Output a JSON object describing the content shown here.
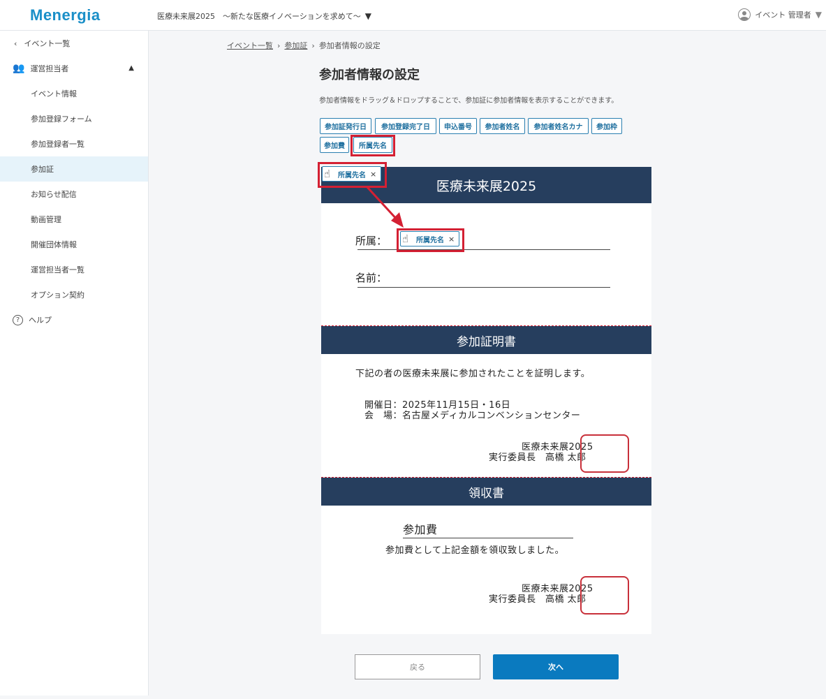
{
  "header": {
    "logo": "Menergia",
    "event_name": "医療未来展2025　～新たな医療イノベーションを求めて～",
    "user_name": "イベント 管理者"
  },
  "sidebar": {
    "back_label": "イベント一覧",
    "group_label": "運営担当者",
    "items": [
      {
        "label": "イベント情報"
      },
      {
        "label": "参加登録フォーム"
      },
      {
        "label": "参加登録者一覧"
      },
      {
        "label": "参加証"
      },
      {
        "label": "お知らせ配信"
      },
      {
        "label": "動画管理"
      },
      {
        "label": "開催団体情報"
      },
      {
        "label": "運営担当者一覧"
      },
      {
        "label": "オプション契約"
      }
    ],
    "help_label": "ヘルプ"
  },
  "breadcrumb": {
    "item1": "イベント一覧",
    "item2": "参加証",
    "current": "参加者情報の設定"
  },
  "page": {
    "title": "参加者情報の設定",
    "description": "参加者情報をドラッグ＆ドロップすることで、参加証に参加者情報を表示することができます。"
  },
  "chips": [
    {
      "label": "参加証発行日"
    },
    {
      "label": "参加登録完了日"
    },
    {
      "label": "申込番号"
    },
    {
      "label": "参加者姓名"
    },
    {
      "label": "参加者姓名カナ"
    },
    {
      "label": "参加枠"
    },
    {
      "label": "参加費"
    },
    {
      "label": "所属先名"
    }
  ],
  "drag_chip": {
    "label": "所属先名",
    "close": "×"
  },
  "dropped_chip": {
    "label": "所属先名",
    "close": "×"
  },
  "badge": {
    "title": "医療未来展2025",
    "affiliation_label": "所属：",
    "name_label": "名前："
  },
  "certificate": {
    "title": "参加証明書",
    "statement": "下記の者の医療未来展に参加されたことを証明します。",
    "date_line": "開催日：2025年11月15日・16日",
    "venue_line": "会　場：名古屋メディカルコンベンションセンター",
    "org": "医療未来展2025",
    "signer": "実行委員長　高橋 太郎"
  },
  "receipt": {
    "title": "領収書",
    "item": "参加費",
    "statement": "参加費として上記金額を領収致しました。",
    "org": "医療未来展2025",
    "signer": "実行委員長　高橋 太郎"
  },
  "buttons": {
    "back": "戻る",
    "next": "次へ"
  },
  "colors": {
    "brand": "#1a8fc8",
    "band": "#263e5e",
    "highlight": "#d42033",
    "primary_button": "#0a7abf"
  }
}
